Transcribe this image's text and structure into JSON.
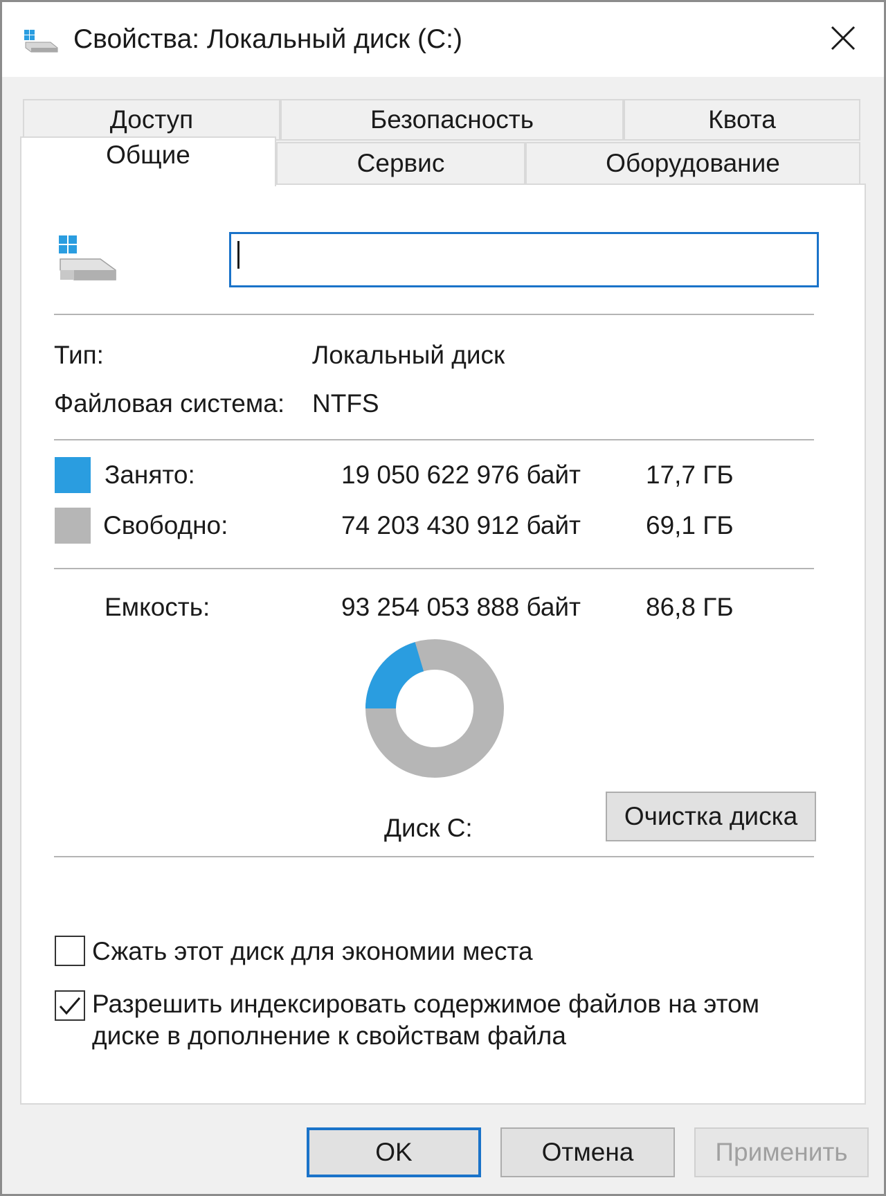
{
  "window": {
    "title": "Свойства: Локальный диск (C:)",
    "icon": "drive-icon",
    "close_icon": "close-icon"
  },
  "tabs": {
    "back_row": [
      "Доступ",
      "Безопасность",
      "Квота"
    ],
    "front_row": [
      "Общие",
      "Сервис",
      "Оборудование"
    ],
    "active": "Общие"
  },
  "general": {
    "name_value": "",
    "type_label": "Тип:",
    "type_value": "Локальный диск",
    "fs_label": "Файловая система:",
    "fs_value": "NTFS",
    "used": {
      "label": "Занято:",
      "bytes": "19 050 622 976 байт",
      "size": "17,7 ГБ",
      "color": "#2a9de0"
    },
    "free": {
      "label": "Свободно:",
      "bytes": "74 203 430 912 байт",
      "size": "69,1 ГБ",
      "color": "#b6b6b6"
    },
    "capacity": {
      "label": "Емкость:",
      "bytes": "93 254 053 888 байт",
      "size": "86,8 ГБ"
    },
    "disk_label": "Диск C:",
    "cleanup_button": "Очистка диска",
    "used_fraction": 0.204,
    "compress_label": "Сжать этот диск для экономии места",
    "compress_checked": false,
    "index_label_line1": "Разрешить индексировать содержимое файлов на этом",
    "index_label_line2": "диске в дополнение к свойствам файла",
    "index_checked": true
  },
  "footer": {
    "ok": "OK",
    "cancel": "Отмена",
    "apply": "Применить"
  }
}
